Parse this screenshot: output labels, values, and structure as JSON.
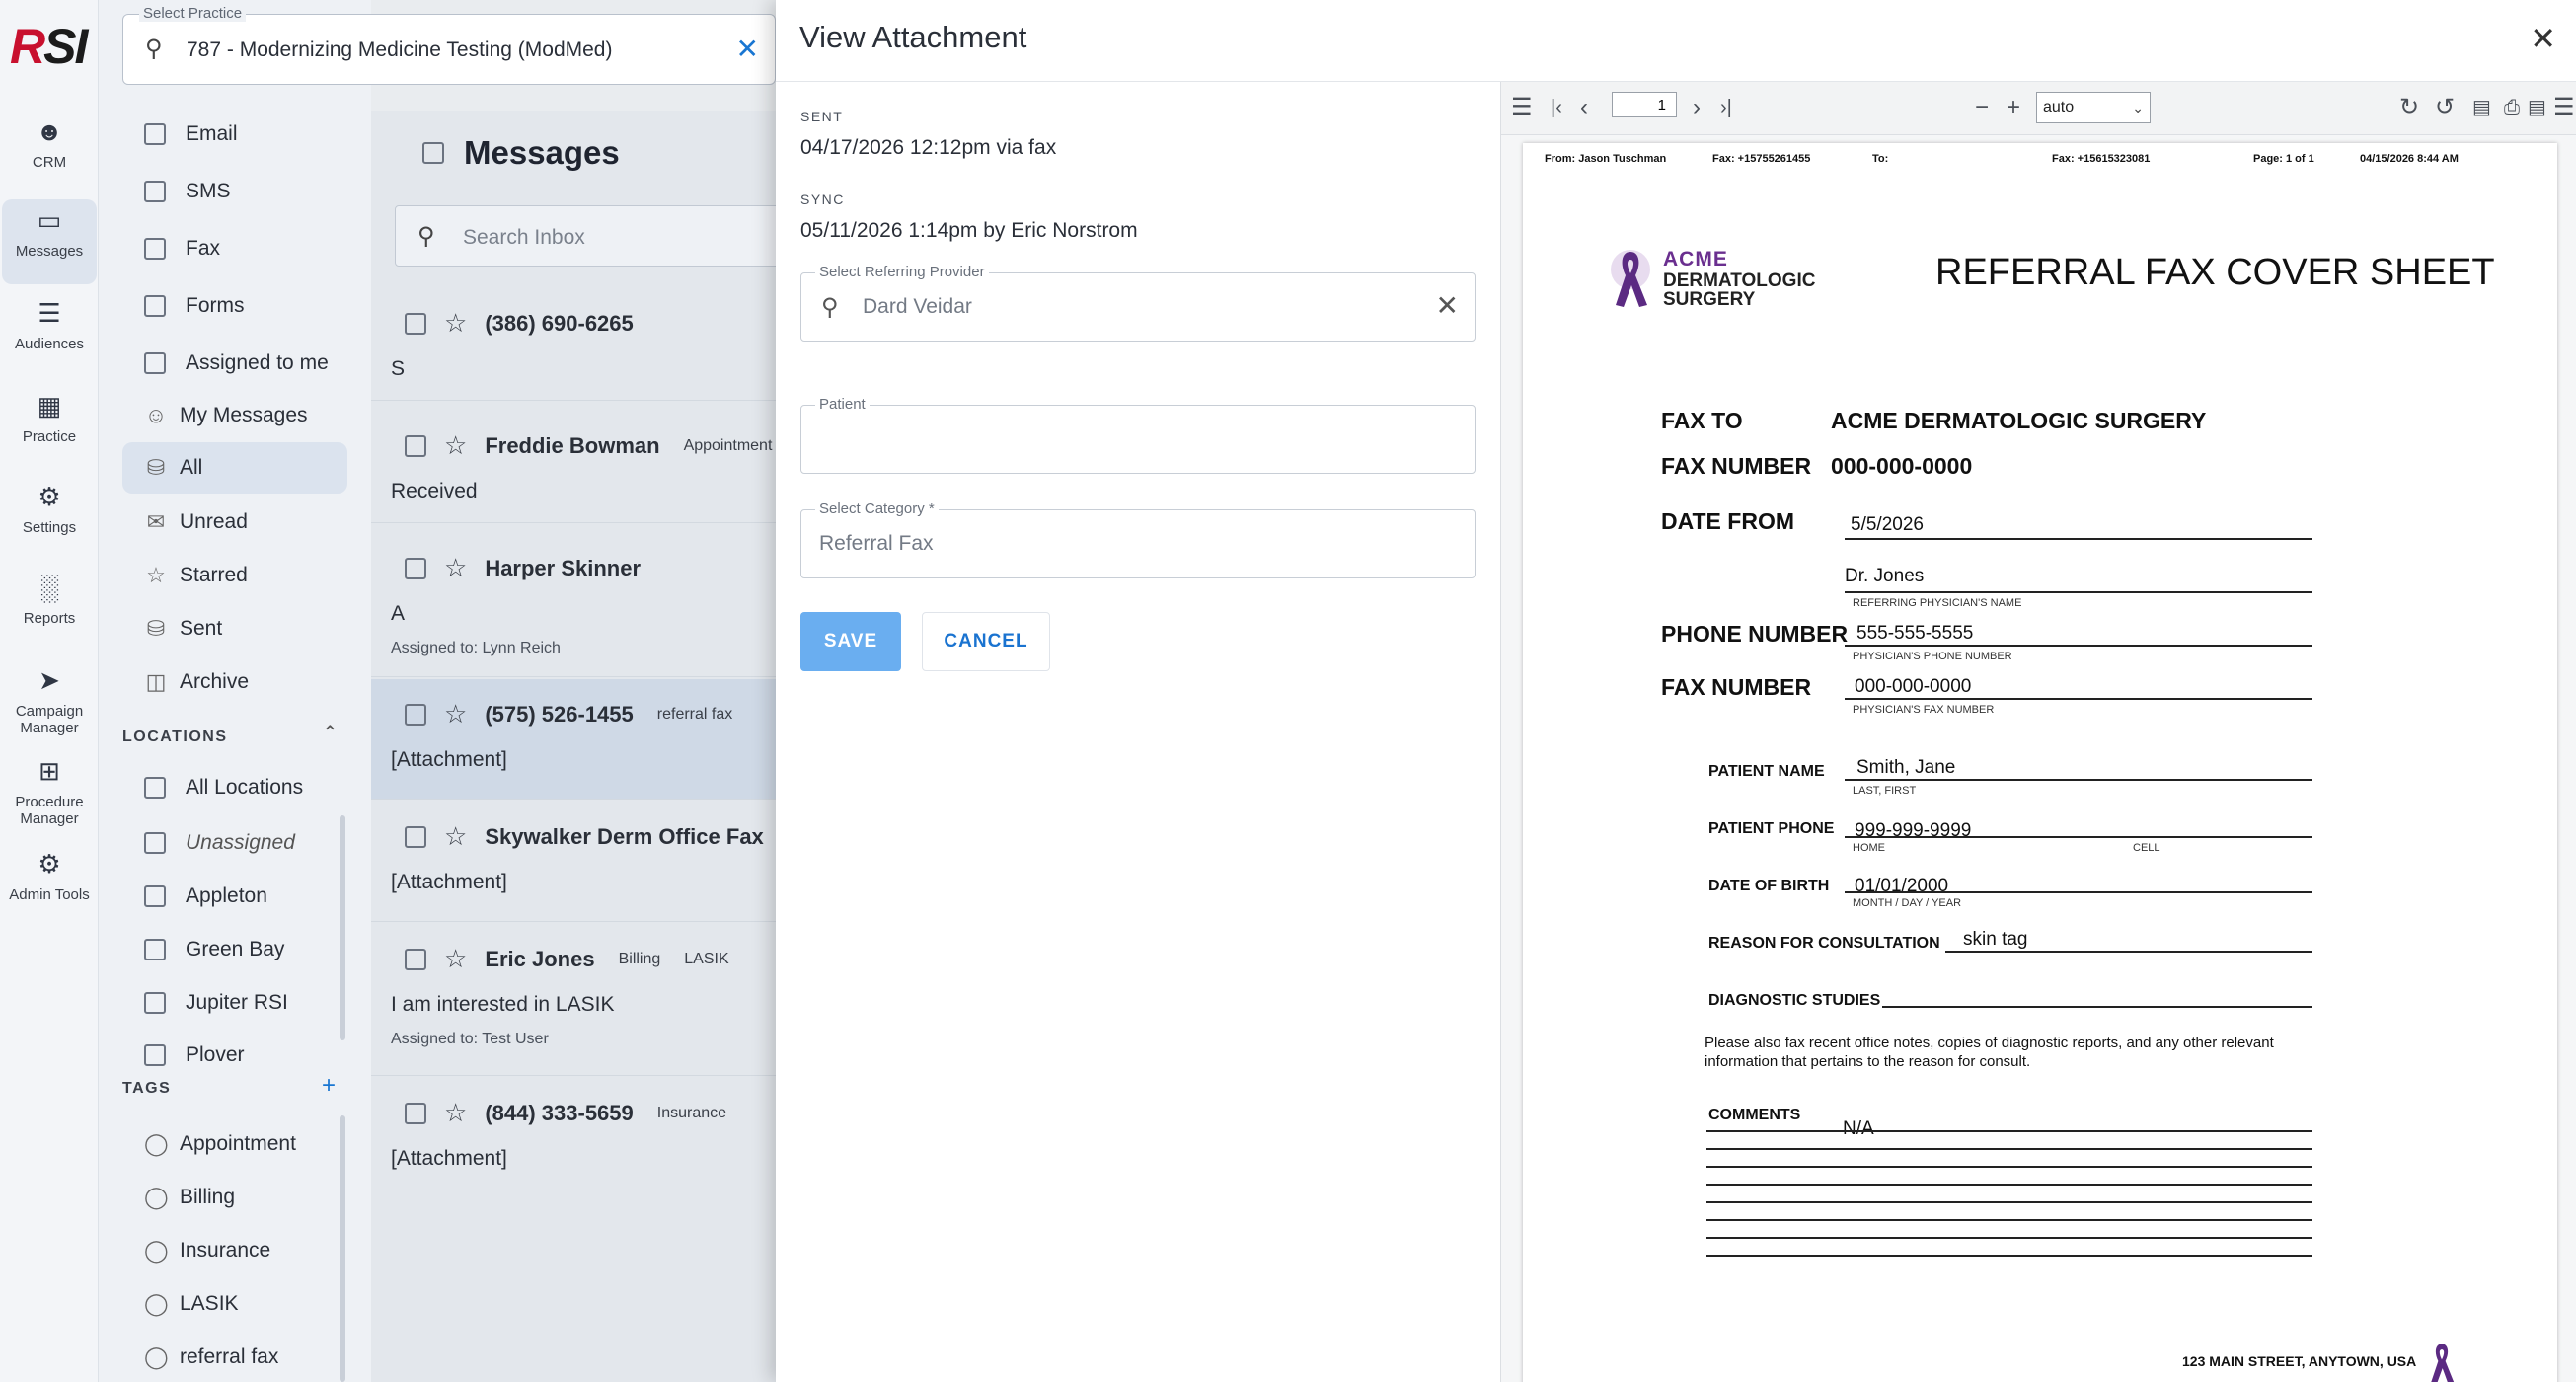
{
  "rail": {
    "logo": "RSI",
    "items": [
      {
        "label": "CRM",
        "icon": "users-icon"
      },
      {
        "label": "Messages",
        "icon": "message-icon"
      },
      {
        "label": "Audiences",
        "icon": "list-icon"
      },
      {
        "label": "Practice",
        "icon": "building-icon"
      },
      {
        "label": "Settings",
        "icon": "gear-icon"
      },
      {
        "label": "Reports",
        "icon": "bar-chart-icon"
      },
      {
        "label": "Campaign Manager",
        "icon": "send-icon"
      },
      {
        "label": "Procedure Manager",
        "icon": "plus-box-icon"
      },
      {
        "label": "Admin Tools",
        "icon": "admin-gear-icon"
      }
    ]
  },
  "practice": {
    "label": "Select Practice",
    "value": "787 - Modernizing Medicine Testing (ModMed)"
  },
  "filters": {
    "channels": [
      "Email",
      "SMS",
      "Fax",
      "Forms",
      "Assigned to me"
    ],
    "my_messages": "My Messages",
    "folders": [
      "All",
      "Unread",
      "Starred",
      "Sent",
      "Archive"
    ],
    "locations_label": "LOCATIONS",
    "locations": [
      "All Locations",
      "Unassigned",
      "Appleton",
      "Green Bay",
      "Jupiter RSI",
      "Plover"
    ],
    "tags_label": "TAGS",
    "tags": [
      "Appointment",
      "Billing",
      "Insurance",
      "LASIK",
      "referral fax"
    ]
  },
  "messages": {
    "title": "Messages",
    "search_placeholder": "Search Inbox",
    "rows": [
      {
        "name": "(386) 690-6265",
        "tag1": "",
        "tag2": "",
        "text": "S",
        "assigned": ""
      },
      {
        "name": "Freddie Bowman",
        "tag1": "Appointment",
        "tag2": "",
        "text": "Received",
        "assigned": ""
      },
      {
        "name": "Harper Skinner",
        "tag1": "",
        "tag2": "",
        "text": "A",
        "assigned": "Assigned to: Lynn Reich"
      },
      {
        "name": "(575) 526-1455",
        "tag1": "referral fax",
        "tag2": "",
        "text": "[Attachment]",
        "assigned": ""
      },
      {
        "name": "Skywalker Derm Office Fax",
        "tag1": "",
        "tag2": "",
        "text": "[Attachment]",
        "assigned": ""
      },
      {
        "name": "Eric Jones",
        "tag1": "Billing",
        "tag2": "LASIK",
        "text": "I am interested in LASIK",
        "assigned": "Assigned to: Test User"
      },
      {
        "name": "(844) 333-5659",
        "tag1": "Insurance",
        "tag2": "",
        "text": "[Attachment]",
        "assigned": ""
      }
    ]
  },
  "dialog": {
    "title": "View Attachment",
    "sent_label": "SENT",
    "sent_value": "04/17/2026 12:12pm via fax",
    "sync_label": "SYNC",
    "sync_value": "05/11/2026 1:14pm by Eric Norstrom",
    "provider_label": "Select Referring Provider",
    "provider_value": "Dard Veidar",
    "patient_label": "Patient",
    "patient_value": "",
    "category_label": "Select Category *",
    "category_value": "Referral Fax",
    "save_label": "SAVE",
    "cancel_label": "CANCEL"
  },
  "viewer": {
    "page_number": "1",
    "zoom": "auto"
  },
  "fax": {
    "header": {
      "from": "From: Jason Tuschman",
      "fax_from": "Fax: +15755261455",
      "to": "To:",
      "fax_to": "Fax: +15615323081",
      "page": "Page: 1 of 1",
      "datetime": "04/15/2026 8:44 AM"
    },
    "logo_line1": "ACME",
    "logo_line2": "DERMATOLOGIC",
    "logo_line3": "SURGERY",
    "title": "REFERRAL FAX COVER SHEET",
    "fax_to_label": "FAX TO",
    "fax_to_value": "ACME DERMATOLOGIC SURGERY",
    "fax_number_label": "FAX NUMBER",
    "fax_number_value": "000-000-0000",
    "date_from_label": "DATE FROM",
    "date_value": "5/5/2026",
    "physician_value": "Dr. Jones",
    "physician_caption": "REFERRING PHYSICIAN'S NAME",
    "phone_label": "PHONE NUMBER",
    "phone_value": "555-555-5555",
    "phone_caption": "PHYSICIAN'S PHONE NUMBER",
    "phys_fax_label": "FAX NUMBER",
    "phys_fax_value": "000-000-0000",
    "phys_fax_caption": "PHYSICIAN'S FAX NUMBER",
    "patient_name_label": "PATIENT NAME",
    "patient_name_value": "Smith, Jane",
    "patient_name_caption": "LAST, FIRST",
    "patient_phone_label": "PATIENT PHONE",
    "patient_phone_value": "999-999-9999",
    "home_caption": "HOME",
    "cell_caption": "CELL",
    "dob_label": "DATE OF BIRTH",
    "dob_value": "01/01/2000",
    "dob_caption": "MONTH / DAY / YEAR",
    "reason_label": "REASON FOR CONSULTATION",
    "reason_value": "skin tag",
    "diagnostic_label": "DIAGNOSTIC STUDIES",
    "note": "Please also fax recent office notes, copies of diagnostic reports, and any other relevant information that pertains to the reason for consult.",
    "comments_label": "COMMENTS",
    "comments_value": "N/A",
    "footer_address": "123 MAIN STREET, ANYTOWN, USA"
  },
  "colors": {
    "accent": "#1976d2",
    "save": "#6aaef0",
    "brand_purple": "#6a2f8f"
  }
}
